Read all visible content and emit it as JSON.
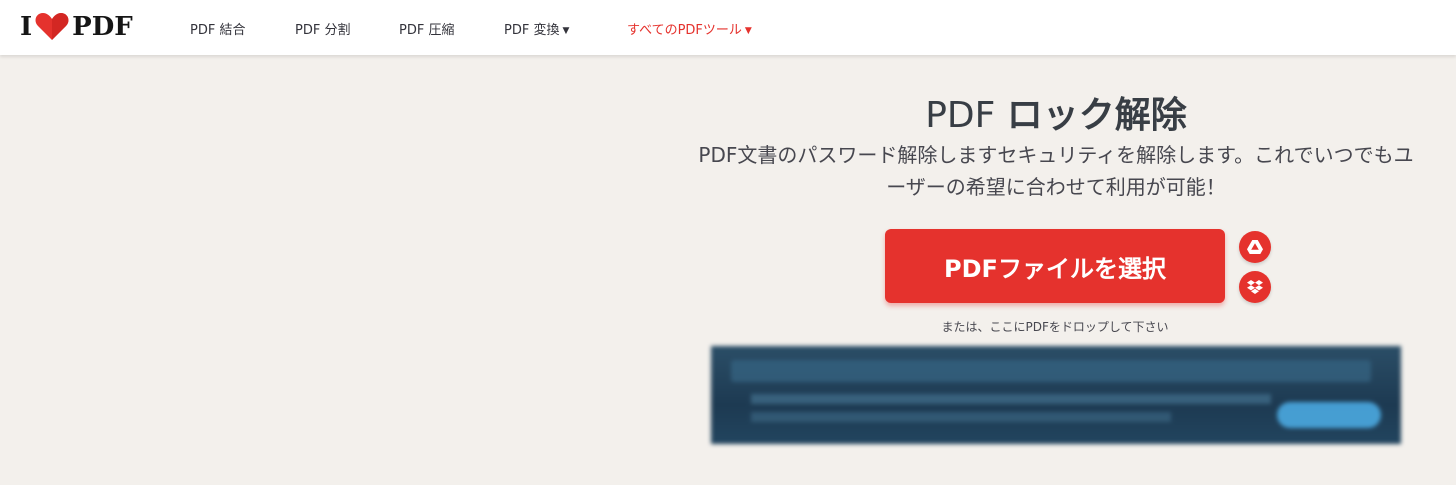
{
  "header": {
    "logo": {
      "left": "I",
      "right": "PDF"
    },
    "nav": [
      {
        "label": "PDF 結合"
      },
      {
        "label": "PDF 分割"
      },
      {
        "label": "PDF 圧縮"
      },
      {
        "label": "PDF 変換",
        "has_dropdown": true
      },
      {
        "label": "すべてのPDFツール",
        "has_dropdown": true,
        "highlight": true
      }
    ]
  },
  "main": {
    "title_prefix": "PDF ",
    "title_bold": "ロック解除",
    "subtitle_line1": "PDF文書のパスワード解除しますセキュリティを解除します。これでいつでもユ",
    "subtitle_line2": "ーザーの希望に合わせて利用が可能！",
    "select_button_label": "PDFファイルを選択",
    "drop_hint": "または、ここにPDFをドロップして下さい",
    "cloud_buttons": [
      {
        "icon": "google-drive-icon"
      },
      {
        "icon": "dropbox-icon"
      }
    ]
  },
  "colors": {
    "brand_red": "#e5322d",
    "background": "#f3f0ec",
    "header_bg": "#ffffff",
    "text": "#33333b"
  }
}
